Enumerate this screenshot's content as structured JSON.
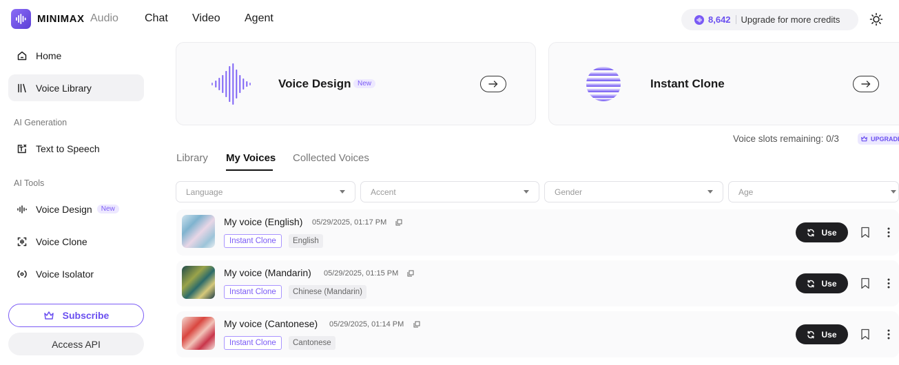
{
  "header": {
    "brand": "MINIMAX",
    "brand_sub": "Audio",
    "nav": [
      "Chat",
      "Video",
      "Agent"
    ],
    "credits": "8,642",
    "upgrade_text": "Upgrade for more credits"
  },
  "sidebar": {
    "home": "Home",
    "voice_library": "Voice Library",
    "section_ai_generation": "AI Generation",
    "text_to_speech": "Text to Speech",
    "section_ai_tools": "AI Tools",
    "voice_design": "Voice Design",
    "voice_design_badge": "New",
    "voice_clone": "Voice Clone",
    "voice_isolator": "Voice Isolator",
    "subscribe": "Subscribe",
    "access_api": "Access API"
  },
  "cards": {
    "voice_design_title": "Voice Design",
    "voice_design_badge": "New",
    "instant_clone_title": "Instant Clone"
  },
  "slots": {
    "text": "Voice slots remaining: 0/3",
    "upgrade": "UPGRADE"
  },
  "tabs": [
    "Library",
    "My Voices",
    "Collected Voices"
  ],
  "filters": {
    "language": "Language",
    "accent": "Accent",
    "gender": "Gender",
    "age": "Age"
  },
  "voices": [
    {
      "name": "My voice (English)",
      "date": "05/29/2025, 01:17 PM",
      "type": "Instant Clone",
      "lang": "English",
      "use": "Use"
    },
    {
      "name": "My voice (Mandarin)",
      "date": "05/29/2025, 01:15 PM",
      "type": "Instant Clone",
      "lang": "Chinese (Mandarin)",
      "use": "Use"
    },
    {
      "name": "My voice (Cantonese)",
      "date": "05/29/2025, 01:14 PM",
      "type": "Instant Clone",
      "lang": "Cantonese",
      "use": "Use"
    }
  ],
  "colors": {
    "accent": "#7a5af5",
    "button_dark": "#1f1f22"
  }
}
